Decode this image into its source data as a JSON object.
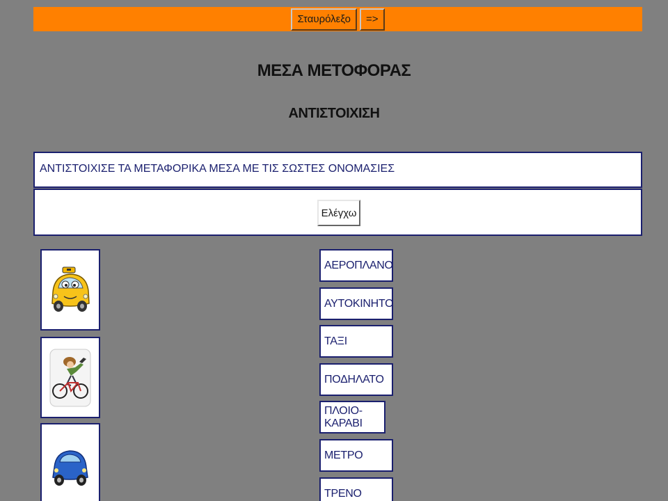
{
  "toolbar": {
    "crossword_label": "Σταυρόλεξο",
    "next_label": "=>"
  },
  "header": {
    "title": "ΜΕΣΑ ΜΕΤΟΦΟΡΑΣ",
    "subtitle": "ΑΝΤΙΣΤΟΙΧΙΣΗ"
  },
  "instruction": "ΑΝΤΙΣΤΟΙΧΙΣΕ ΤΑ ΜΕΤΑΦΟΡΙΚΑ ΜΕΣΑ ΜΕ ΤΙΣ ΣΩΣΤΕΣ ΟΝΟΜΑΣΙΕΣ",
  "check_label": "Ελέγχω",
  "images": [
    {
      "icon": "taxi-icon"
    },
    {
      "icon": "bicycle-icon"
    },
    {
      "icon": "car-icon"
    }
  ],
  "words": [
    "ΑΕΡΟΠΛΑΝΟ",
    "ΑΥΤΟΚΙΝΗΤΟ",
    "ΤΑΞΙ",
    "ΠΟΔΗΛΑΤΟ",
    "ΠΛΟΙΟ-ΚΑΡΑΒΙ",
    "ΜΕΤΡΟ",
    "ΤΡΕΝΟ"
  ],
  "colors": {
    "background": "#808080",
    "toolbar": "#ff8000",
    "border": "#1a1f6e"
  }
}
